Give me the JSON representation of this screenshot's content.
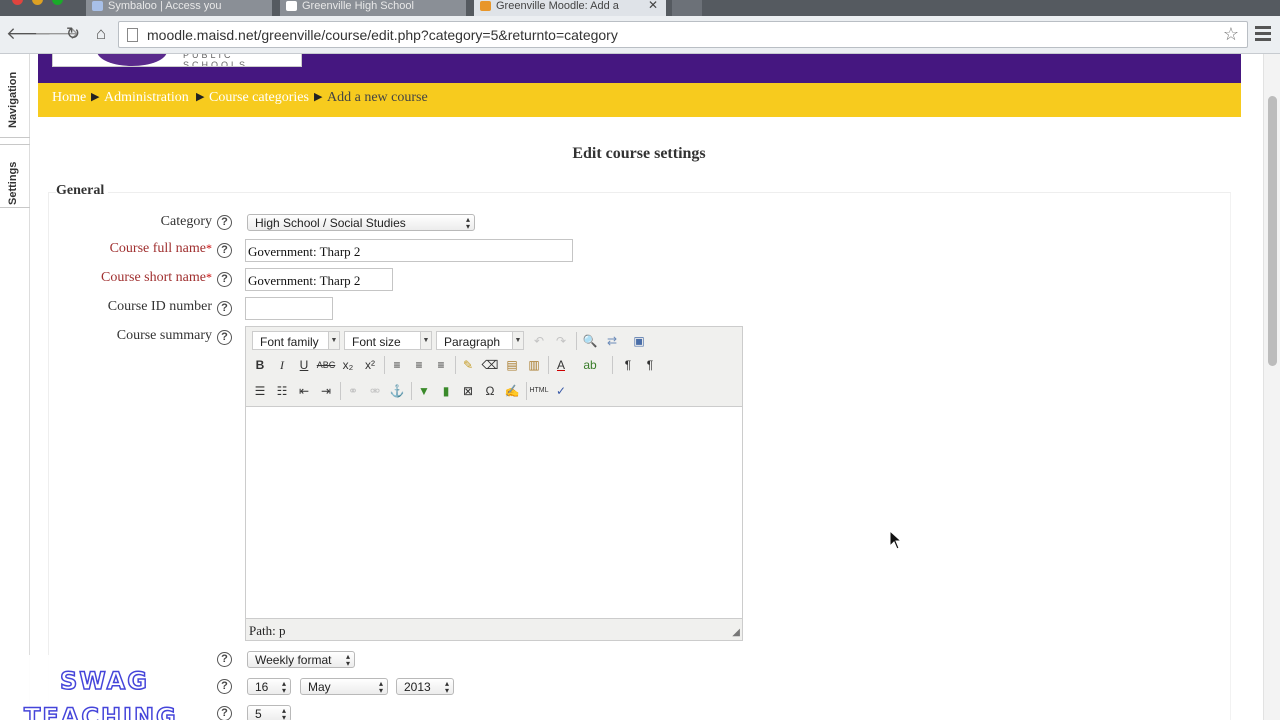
{
  "browser": {
    "tabs": [
      {
        "title": "Symbaloo | Access you"
      },
      {
        "title": "Greenville High School"
      },
      {
        "title": "Greenville Moodle: Add a"
      }
    ],
    "url": "moodle.maisd.net/greenville/course/edit.php?category=5&returnto=category"
  },
  "dock": {
    "items": [
      "Navigation",
      "Settings"
    ]
  },
  "logo": {
    "caption": "PUBLIC SCHOOLS"
  },
  "breadcrumb": {
    "items": [
      "Home",
      "Administration",
      "Course categories",
      "Add a new course"
    ]
  },
  "page": {
    "title": "Edit course settings"
  },
  "section": {
    "legend": "General"
  },
  "form": {
    "category_label": "Category",
    "category_value": "High School / Social Studies",
    "fullname_label": "Course full name",
    "fullname_value": "Government: Tharp 2",
    "shortname_label": "Course short name",
    "shortname_value": "Government: Tharp 2",
    "idnumber_label": "Course ID number",
    "idnumber_value": "",
    "summary_label": "Course summary",
    "format_value": "Weekly format",
    "start_day": "16",
    "start_month": "May",
    "start_year": "2013",
    "sections_value": "5",
    "required_mark": "*",
    "help_glyph": "?"
  },
  "editor": {
    "font_family": "Font family",
    "font_size": "Font size",
    "paragraph": "Paragraph",
    "path": "Path: p"
  },
  "watermark": {
    "line1": "SWAG",
    "line2": "TEACHING"
  }
}
